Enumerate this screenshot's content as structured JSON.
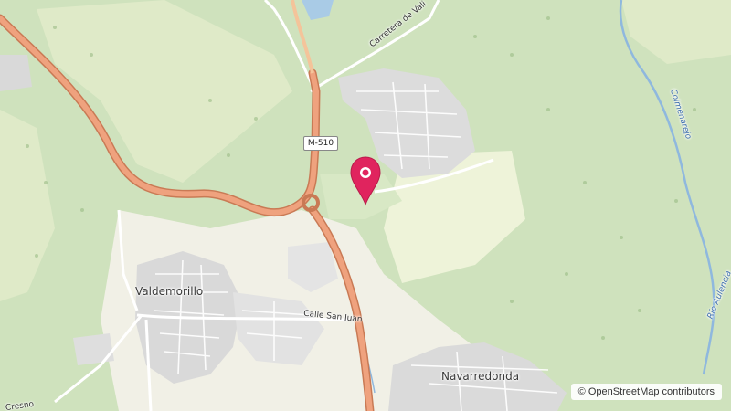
{
  "map": {
    "labels": {
      "valdemorillo": "Valdemorillo",
      "navarredonda": "Navarredonda",
      "calle_san_juan": "Calle San Juan",
      "carretera": "Carretera de Vali",
      "colmenarejo": "Colmenarejo",
      "rio_aulencia": "Río Aulencia",
      "calle_left": "Cresno"
    },
    "road_shield": "M-510",
    "attribution": "© OpenStreetMap contributors",
    "marker": {
      "icon": "map-pin-icon",
      "color": "#e0245e"
    },
    "colors": {
      "forest": "#cfe2bd",
      "meadow": "#e6efcf",
      "scrub": "#eef3d9",
      "urban": "#dadada",
      "water": "#a9cbe6",
      "highway": "#e8926a",
      "road_casing": "#c97a55"
    }
  }
}
